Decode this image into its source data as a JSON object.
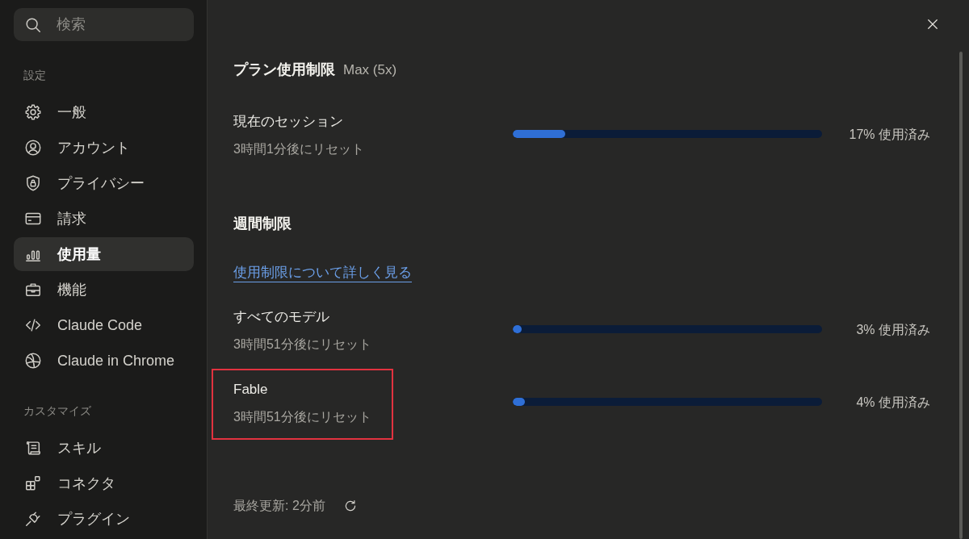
{
  "sidebar": {
    "search": {
      "placeholder": "検索"
    },
    "sections": [
      {
        "title": "設定",
        "items": [
          {
            "label": "一般",
            "selected": false
          },
          {
            "label": "アカウント",
            "selected": false
          },
          {
            "label": "プライバシー",
            "selected": false
          },
          {
            "label": "請求",
            "selected": false
          },
          {
            "label": "使用量",
            "selected": true
          },
          {
            "label": "機能",
            "selected": false
          },
          {
            "label": "Claude Code",
            "selected": false
          },
          {
            "label": "Claude in Chrome",
            "selected": false
          }
        ]
      },
      {
        "title": "カスタマイズ",
        "items": [
          {
            "label": "スキル",
            "selected": false
          },
          {
            "label": "コネクタ",
            "selected": false
          },
          {
            "label": "プラグイン",
            "selected": false
          }
        ]
      }
    ]
  },
  "plan_usage": {
    "title": "プラン使用制限",
    "plan": "Max (5x)",
    "meters": [
      {
        "name": "現在のセッション",
        "reset": "3時間1分後にリセット",
        "level": 0.17,
        "reading": "17% 使用済み",
        "highlighted": false
      }
    ]
  },
  "weekly_limits": {
    "title": "週間制限",
    "link": "使用制限について詳しく見る",
    "meters": [
      {
        "name": "すべてのモデル",
        "reset": "3時間51分後にリセット",
        "level": 0.03,
        "reading": "3% 使用済み",
        "highlighted": false
      },
      {
        "name": "Fable",
        "reset": "3時間51分後にリセット",
        "level": 0.04,
        "reading": "4% 使用済み",
        "highlighted": true
      }
    ]
  },
  "footer": {
    "last_updated": "最終更新: 2分前"
  }
}
